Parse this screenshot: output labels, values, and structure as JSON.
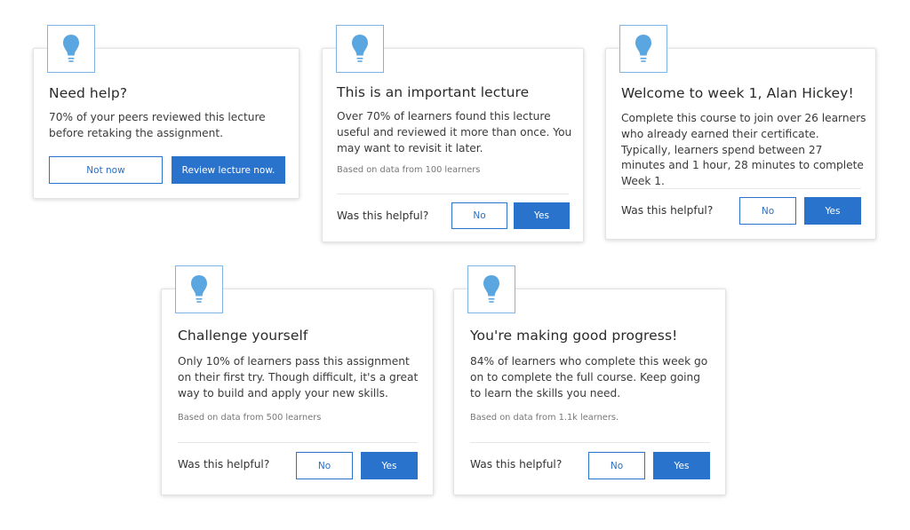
{
  "colors": {
    "accent": "#2a73cc",
    "bulb": "#5aa6e0",
    "border": "#7fb5e6"
  },
  "cards": [
    {
      "icon": "lightbulb-icon",
      "title": "Need help?",
      "body": "70% of your peers reviewed this lecture before retaking the assignment.",
      "secondary_button": "Not now",
      "primary_button": "Review lecture now."
    },
    {
      "icon": "lightbulb-icon",
      "title": "This is an important lecture",
      "body": "Over 70% of learners found this lecture useful and reviewed it more than once. You may want to revisit it later.",
      "note": "Based on data from 100 learners",
      "question": "Was this helpful?",
      "no_label": "No",
      "yes_label": "Yes"
    },
    {
      "icon": "lightbulb-icon",
      "title": "Welcome to week 1, Alan Hickey!",
      "body": "Complete this course to join over 26 learners who already earned their certificate. Typically, learners spend between 27 minutes and 1 hour, 28 minutes to complete Week 1.",
      "question": "Was this helpful?",
      "no_label": "No",
      "yes_label": "Yes"
    },
    {
      "icon": "lightbulb-icon",
      "title": "Challenge yourself",
      "body": "Only 10% of learners pass this assignment on their first try. Though difficult, it's a great way to build and apply your new skills.",
      "note": "Based on data from 500 learners",
      "question": "Was this helpful?",
      "no_label": "No",
      "yes_label": "Yes"
    },
    {
      "icon": "lightbulb-icon",
      "title": "You're making good progress!",
      "body": "84% of learners who complete this week go on to complete the full course. Keep going to learn the skills you need.",
      "note": "Based on data from 1.1k learners.",
      "question": "Was this helpful?",
      "no_label": "No",
      "yes_label": "Yes"
    }
  ]
}
